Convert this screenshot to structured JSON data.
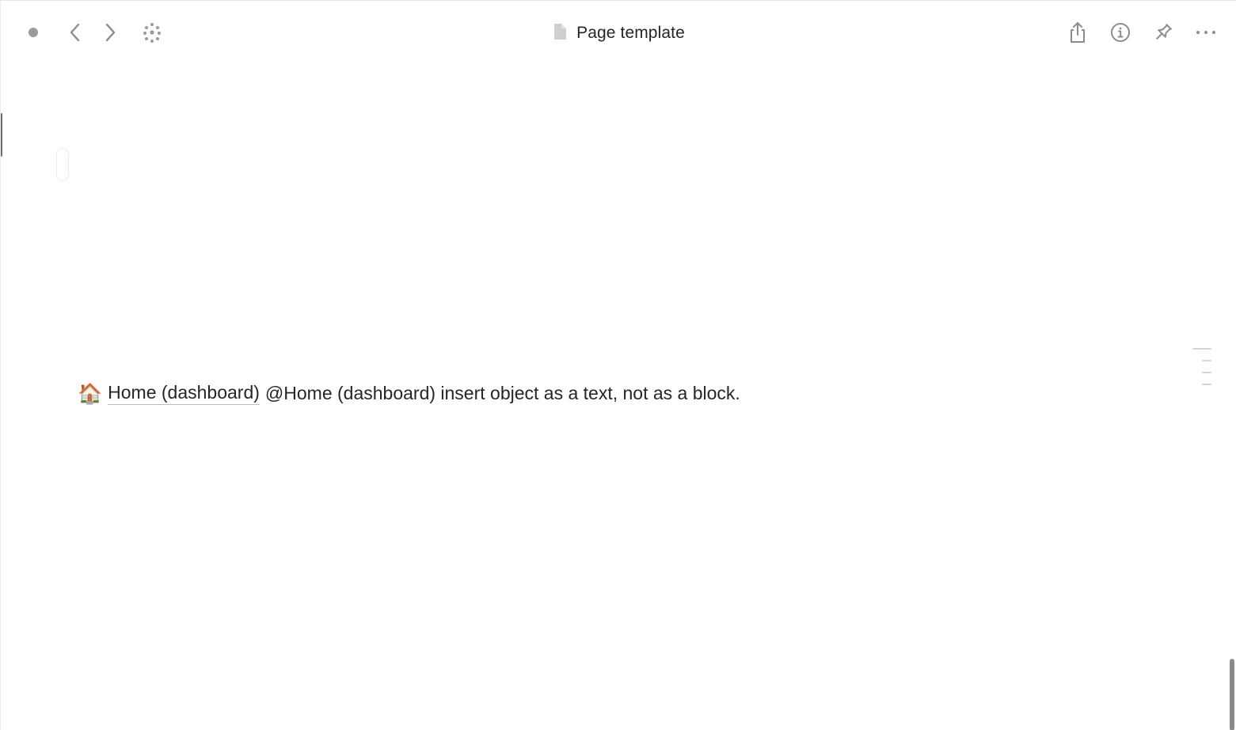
{
  "header": {
    "title": "Page template",
    "title_icon": "document-icon",
    "left_icons": [
      "status-dot-icon",
      "chevron-left-icon",
      "chevron-right-icon",
      "graph-icon"
    ],
    "right_icons": [
      "share-icon",
      "info-icon",
      "pin-icon",
      "more-icon"
    ]
  },
  "content": {
    "emoji": "🏠",
    "mention_label": "Home (dashboard)",
    "text": "@Home (dashboard) insert object as a text, not as a block."
  },
  "colors": {
    "text": "#252525",
    "icon": "#8c8c8c",
    "status_dot": "#9a9a9a",
    "scrollbar": "#8a8a8a"
  }
}
